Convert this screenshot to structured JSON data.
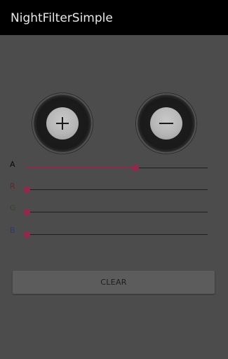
{
  "app": {
    "title": "NightFilterSimple"
  },
  "buttons": {
    "increase_icon": "plus-icon",
    "decrease_icon": "minus-icon"
  },
  "sliders": [
    {
      "label": "A",
      "value": 0.6,
      "label_color": "#0a0a0a"
    },
    {
      "label": "R",
      "value": 0.0,
      "label_color": "#7a1c1c"
    },
    {
      "label": "G",
      "value": 0.0,
      "label_color": "#2e4a2e"
    },
    {
      "label": "B",
      "value": 0.0,
      "label_color": "#2a3a78"
    }
  ],
  "clear_button": {
    "label": "CLEAR"
  },
  "colors": {
    "accent": "#8f2b4a",
    "overlay_background": "#4c4c4c"
  }
}
